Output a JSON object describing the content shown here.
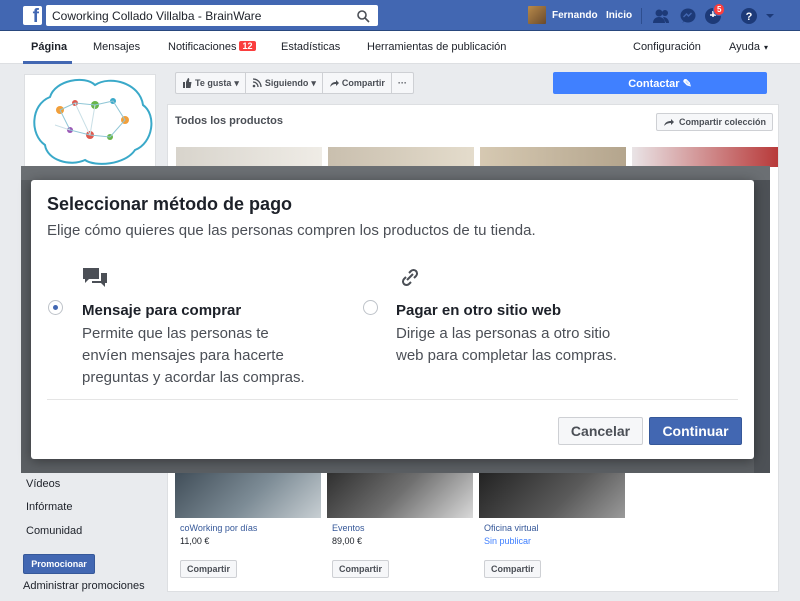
{
  "topbar": {
    "logo": "f",
    "search_value": "Coworking Collado Villalba - BrainWare",
    "user_name": "Fernando",
    "home_label": "Inicio",
    "notification_count": "5",
    "brand_color": "#4267b2"
  },
  "pagenav": {
    "items": [
      "Página",
      "Mensajes",
      "Notificaciones",
      "Estadísticas",
      "Herramientas de publicación"
    ],
    "notifications_badge": "12",
    "settings_label": "Configuración",
    "help_label": "Ayuda"
  },
  "sidebar": {
    "links": [
      "Vídeos",
      "Infórmate",
      "Comunidad"
    ],
    "promote_label": "Promocionar",
    "manage_promotions_label": "Administrar promociones"
  },
  "actionbar": {
    "like_label": "Te gusta",
    "following_label": "Siguiendo",
    "share_label": "Compartir",
    "more_label": "···",
    "contact_label": "Contactar"
  },
  "products": {
    "header": "Todos los productos",
    "share_collection_label": "Compartir colección",
    "cards": [
      {
        "title": "coWorking por días",
        "price": "11,00 €",
        "share": "Compartir"
      },
      {
        "title": "Eventos",
        "price": "89,00 €",
        "share": "Compartir"
      },
      {
        "title": "Oficina virtual",
        "price": "Sin publicar",
        "share": "Compartir"
      }
    ]
  },
  "modal": {
    "title": "Seleccionar método de pago",
    "subtitle": "Elige cómo quieres que las personas compren los productos de tu tienda.",
    "options": [
      {
        "title": "Mensaje para comprar",
        "desc_lines": [
          "Permite que las personas te",
          "envíen mensajes para hacerte",
          "preguntas y acordar las compras."
        ],
        "selected": true,
        "icon": "chat-bubbles-icon"
      },
      {
        "title": "Pagar en otro sitio web",
        "desc_lines": [
          "Dirige a las personas a otro sitio",
          "web para completar las compras."
        ],
        "selected": false,
        "icon": "link-icon"
      }
    ],
    "cancel_label": "Cancelar",
    "continue_label": "Continuar"
  }
}
